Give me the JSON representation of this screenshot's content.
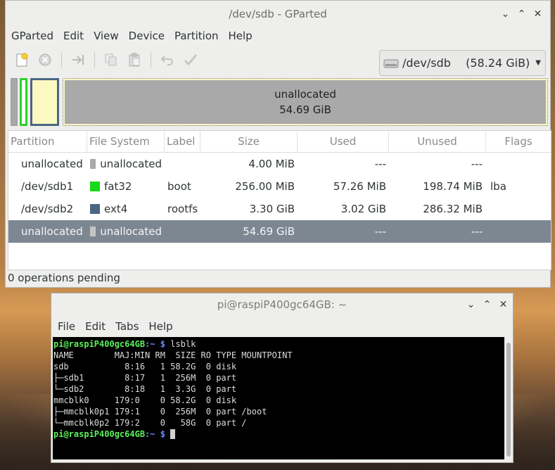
{
  "gparted": {
    "title": "/dev/sdb - GParted",
    "window_buttons": {
      "minimize": "⌄",
      "maximize": "⌃",
      "close": "✕"
    },
    "menu": [
      "GParted",
      "Edit",
      "View",
      "Device",
      "Partition",
      "Help"
    ],
    "toolbar_icons": [
      "new-icon",
      "delete-icon",
      "resize-move-icon",
      "copy-icon",
      "paste-icon",
      "undo-icon",
      "apply-icon"
    ],
    "device": {
      "path": "/dev/sdb",
      "size": "(58.24 GiB)"
    },
    "diskmap": {
      "big_label": "unallocated",
      "big_size": "54.69 GiB"
    },
    "columns": [
      "Partition",
      "File System",
      "Label",
      "Size",
      "Used",
      "Unused",
      "Flags"
    ],
    "rows": [
      {
        "partition": "unallocated",
        "fs": "unallocated",
        "color": "#a9a9a9",
        "label": "",
        "size": "4.00 MiB",
        "used": "---",
        "unused": "---",
        "flags": ""
      },
      {
        "partition": "/dev/sdb1",
        "fs": "fat32",
        "color": "#18d918",
        "label": "boot",
        "size": "256.00 MiB",
        "used": "57.26 MiB",
        "unused": "198.74 MiB",
        "flags": "lba"
      },
      {
        "partition": "/dev/sdb2",
        "fs": "ext4",
        "color": "#4a6683",
        "label": "rootfs",
        "size": "3.30 GiB",
        "used": "3.02 GiB",
        "unused": "286.32 MiB",
        "flags": ""
      },
      {
        "partition": "unallocated",
        "fs": "unallocated",
        "color": "#c4c4c4",
        "label": "",
        "size": "54.69 GiB",
        "used": "---",
        "unused": "---",
        "flags": "",
        "selected": true
      }
    ],
    "status": "0 operations pending"
  },
  "terminal": {
    "title": "pi@raspiP400gc64GB: ~",
    "window_buttons": {
      "minimize": "⌄",
      "maximize": "⌃",
      "close": "✕"
    },
    "menu": [
      "File",
      "Edit",
      "Tabs",
      "Help"
    ],
    "prompt_user": "pi@raspiP400gc64GB",
    "prompt_path": "~",
    "prompt_symbol": "$",
    "command": "lsblk",
    "output": [
      "NAME        MAJ:MIN RM  SIZE RO TYPE MOUNTPOINT",
      "sdb           8:16   1 58.2G  0 disk ",
      "├─sdb1        8:17   1  256M  0 part ",
      "└─sdb2        8:18   1  3.3G  0 part ",
      "mmcblk0     179:0    0 58.2G  0 disk ",
      "├─mmcblk0p1 179:1    0  256M  0 part /boot",
      "└─mmcblk0p2 179:2    0   58G  0 part /"
    ]
  }
}
